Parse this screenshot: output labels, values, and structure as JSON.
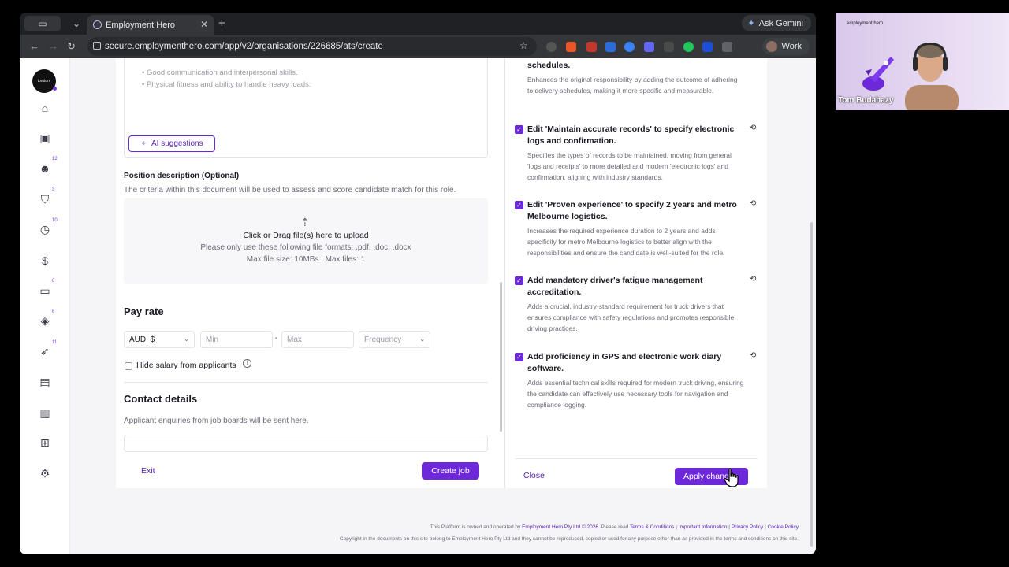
{
  "browser": {
    "tab_title": "Employment Hero",
    "gemini_label": "Ask Gemini",
    "url": "secure.employmenthero.com/app/v2/organisations/226685/ats/create",
    "profile_label": "Work"
  },
  "sidebar": {
    "logo_text": "tomtom",
    "items": [
      {
        "icon": "home-icon",
        "badge": ""
      },
      {
        "icon": "briefcase-icon",
        "badge": ""
      },
      {
        "icon": "people-icon",
        "badge": "12"
      },
      {
        "icon": "shield-check-icon",
        "badge": "3"
      },
      {
        "icon": "clock-icon",
        "badge": "10"
      },
      {
        "icon": "dollar-icon",
        "badge": ""
      },
      {
        "icon": "chat-icon",
        "badge": "8"
      },
      {
        "icon": "learning-icon",
        "badge": "6"
      },
      {
        "icon": "rocket-icon",
        "badge": "11"
      },
      {
        "icon": "gift-icon",
        "badge": ""
      },
      {
        "icon": "chart-icon",
        "badge": ""
      },
      {
        "icon": "org-chart-icon",
        "badge": ""
      },
      {
        "icon": "settings-icon",
        "badge": ""
      }
    ]
  },
  "form": {
    "bullets": [
      "Good communication and interpersonal skills.",
      "Physical fitness and ability to handle heavy loads."
    ],
    "ai_suggestions_label": "AI suggestions",
    "position_description": {
      "label": "Position description (Optional)",
      "help": "The criteria within this document will be used to assess and score candidate match for this role.",
      "upload_title": "Click or Drag file(s) here to upload",
      "upload_formats": "Please only use these following file formats: .pdf, .doc, .docx",
      "upload_limits": "Max file size: 10MBs | Max files: 1"
    },
    "pay_rate": {
      "heading": "Pay rate",
      "currency": "AUD, $",
      "min_placeholder": "Min",
      "max_placeholder": "Max",
      "frequency_placeholder": "Frequency",
      "hide_salary_label": "Hide salary from applicants"
    },
    "contact": {
      "heading": "Contact details",
      "help": "Applicant enquiries from job boards will be sent here."
    },
    "exit_label": "Exit",
    "create_label": "Create job"
  },
  "suggestions": {
    "partial_title": "schedules.",
    "partial_desc": "Enhances the original responsibility by adding the outcome of adhering to delivery schedules, making it more specific and measurable.",
    "items": [
      {
        "title": "Edit 'Maintain accurate records' to specify electronic logs and confirmation.",
        "desc": "Specifies the types of records to be maintained, moving from general 'logs and receipts' to more detailed and modern 'electronic logs' and confirmation, aligning with industry standards.",
        "checked": true
      },
      {
        "title": "Edit 'Proven experience' to specify 2 years and metro Melbourne logistics.",
        "desc": "Increases the required experience duration to 2 years and adds specificity for metro Melbourne logistics to better align with the responsibilities and ensure the candidate is well-suited for the role.",
        "checked": true
      },
      {
        "title": "Add mandatory driver's fatigue management accreditation.",
        "desc": "Adds a crucial, industry-standard requirement for truck drivers that ensures compliance with safety regulations and promotes responsible driving practices.",
        "checked": true
      },
      {
        "title": "Add proficiency in GPS and electronic work diary software.",
        "desc": "Adds essential technical skills required for modern truck driving, ensuring the candidate can effectively use necessary tools for navigation and compliance logging.",
        "checked": true
      }
    ],
    "close_label": "Close",
    "apply_label": "Apply changes"
  },
  "footer": {
    "line1_prefix": "This Platform is owned and operated by",
    "company_link": "Employment Hero Pty Ltd © 2026.",
    "please_read": "Please read",
    "terms": "Terms & Conditions",
    "sep1": "|",
    "important": "Important Information",
    "sep2": "|",
    "privacy": "Privacy Policy",
    "sep3": "|",
    "cookie": "Cookie Policy",
    "line2": "Copyright in the documents on this site belong to Employment Hero Pty Ltd and they cannot be reproduced, copied or used for any purpose other than as provided in the terms and conditions on this site."
  },
  "video": {
    "brand": "employment hero",
    "participant_name": "Tom Budahazy"
  }
}
